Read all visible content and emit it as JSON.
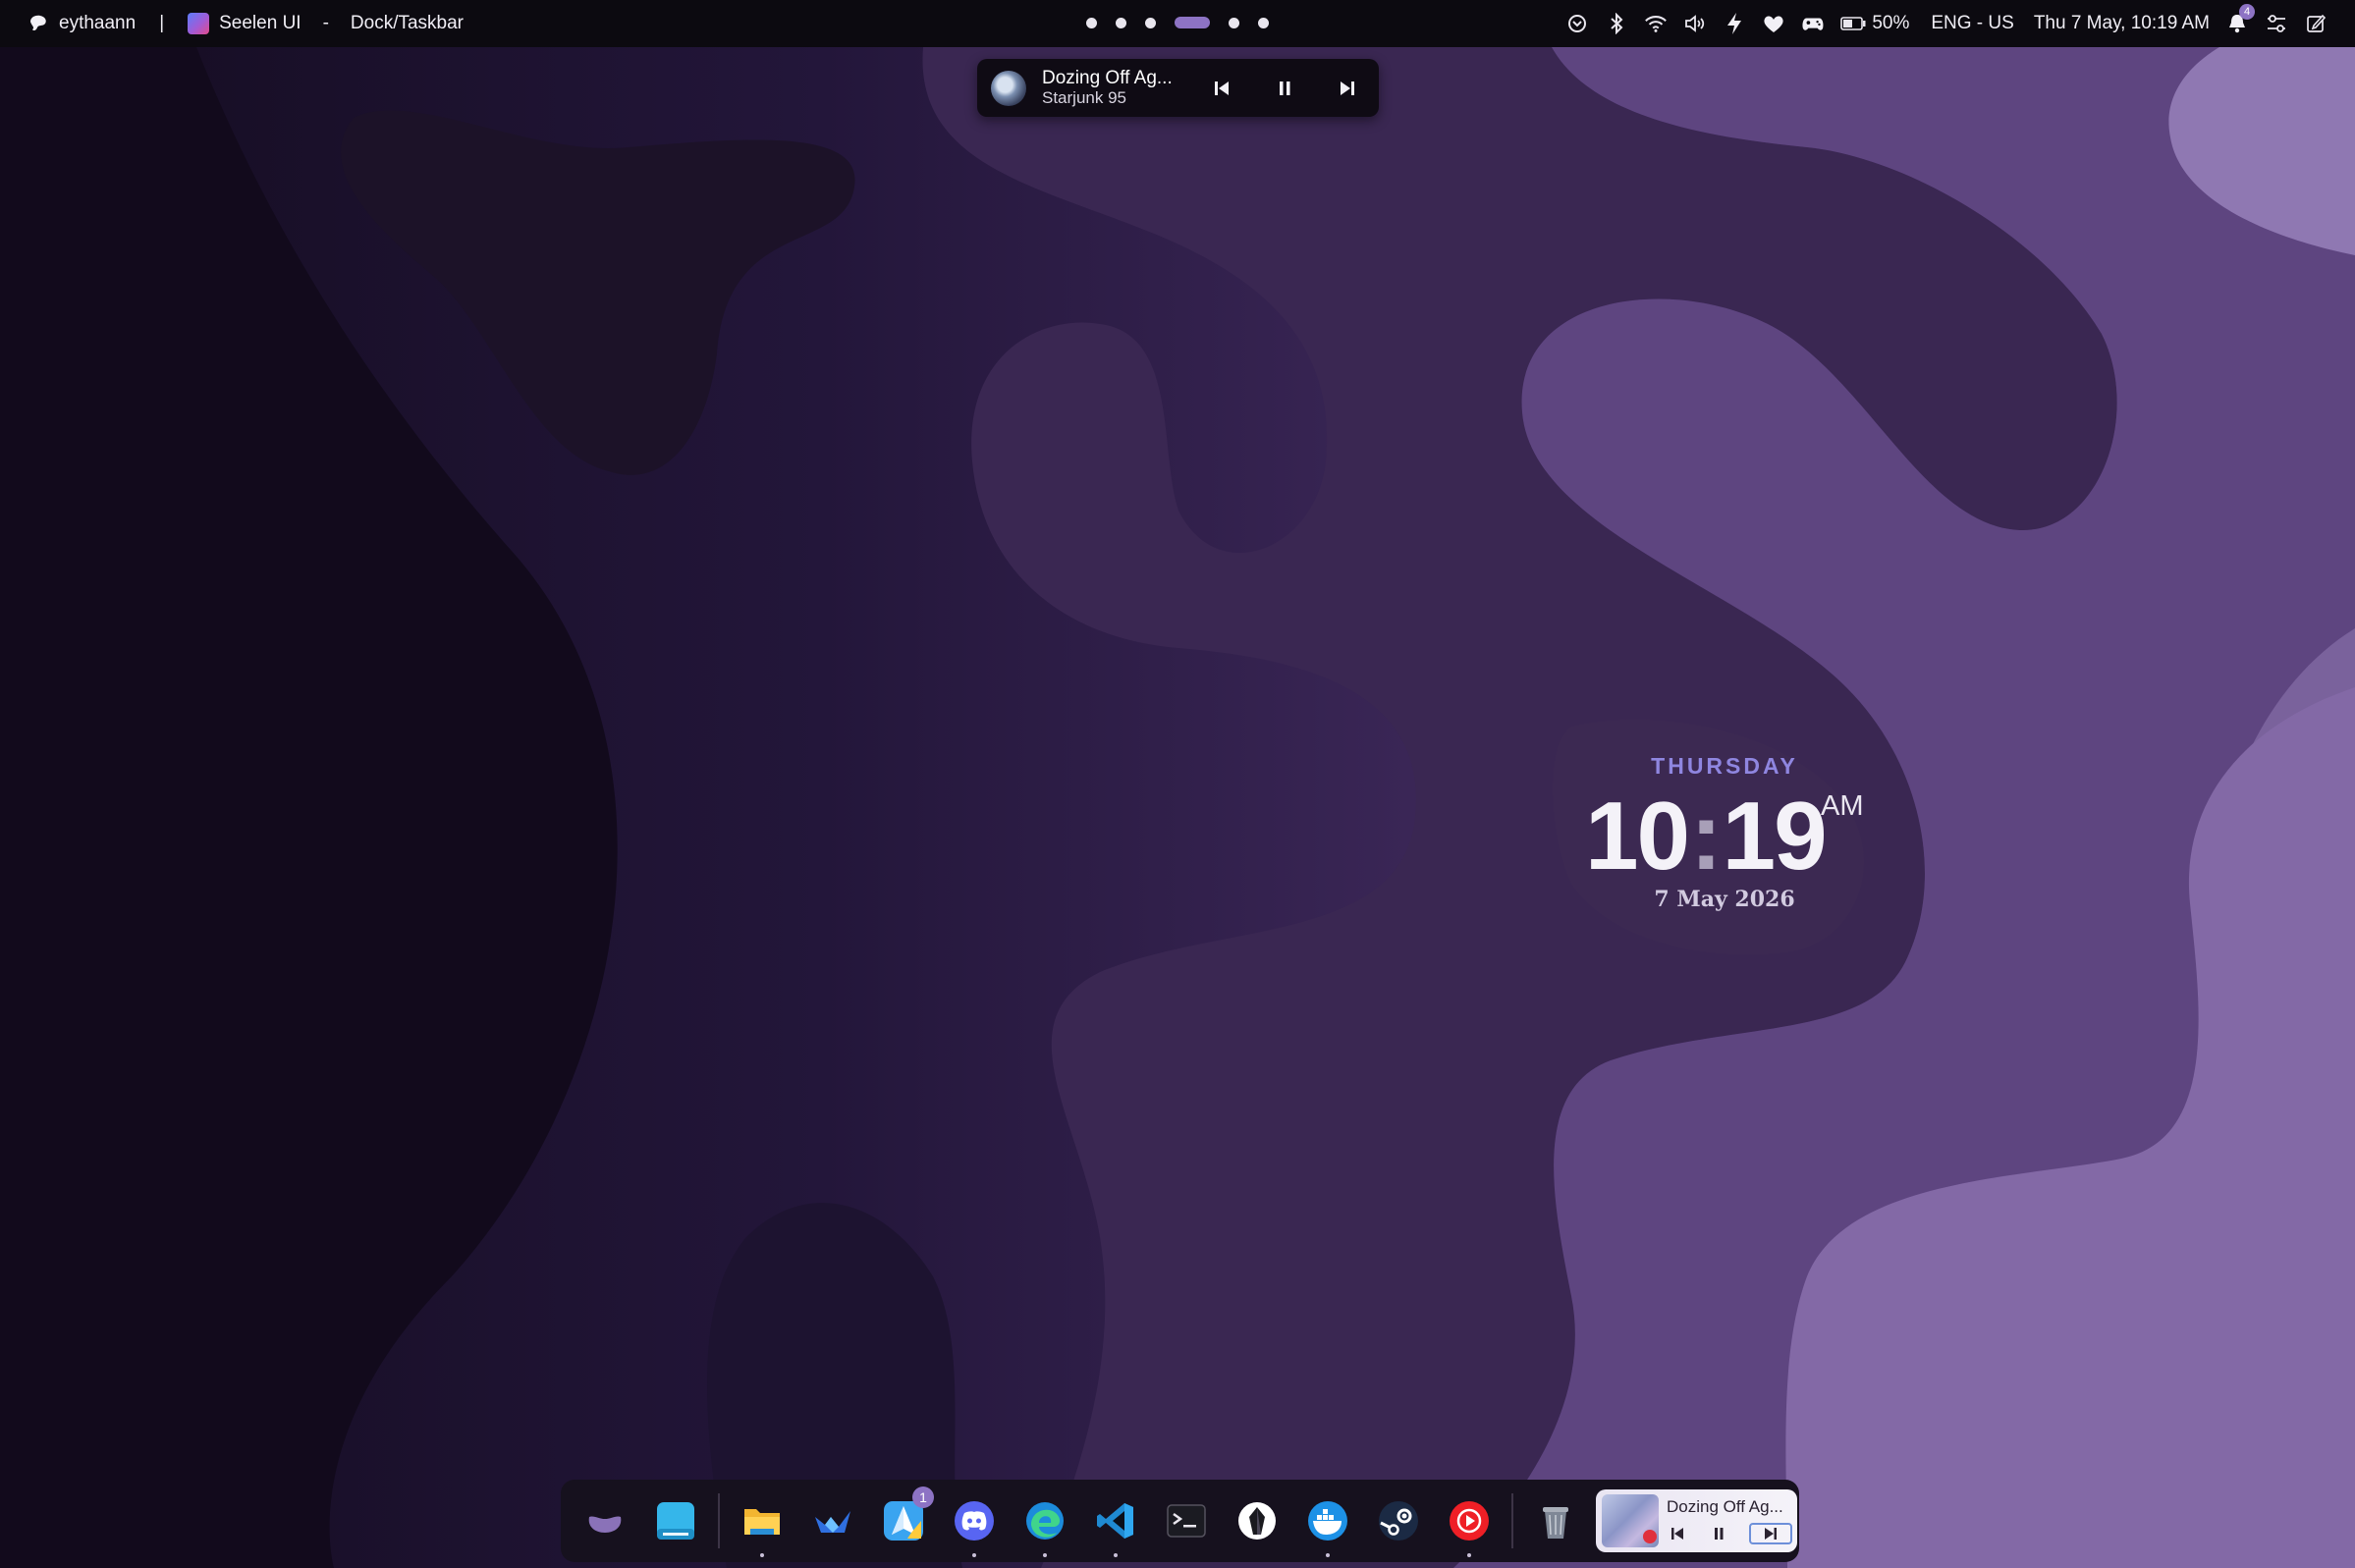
{
  "topbar": {
    "user_name": "eythaann",
    "separator": "|",
    "app_name": "Seelen UI",
    "title_separator": "-",
    "window_title": "Dock/Taskbar",
    "workspaces_count": 6,
    "active_workspace_index": 3,
    "battery_percent": "50%",
    "language": "ENG - US",
    "datetime": "Thu 7 May, 10:19 AM",
    "notification_count": "4"
  },
  "media_popup": {
    "title": "Dozing Off Ag...",
    "artist": "Starjunk 95"
  },
  "clock_widget": {
    "day": "THURSDAY",
    "hours": "10",
    "colon": ":",
    "minutes": "19",
    "ampm": "AM",
    "date": "7 May 2026"
  },
  "dock": {
    "items": [
      {
        "name": "seelen-app-launcher-icon",
        "running": false
      },
      {
        "name": "desktop-icon",
        "running": false
      },
      {
        "name": "file-explorer-icon",
        "running": true
      },
      {
        "name": "windsurf-icon",
        "running": false
      },
      {
        "name": "send-app-icon",
        "running": false,
        "badge": "1"
      },
      {
        "name": "discord-icon",
        "running": true
      },
      {
        "name": "edge-icon",
        "running": true
      },
      {
        "name": "vscode-icon",
        "running": true
      },
      {
        "name": "terminal-icon",
        "running": false
      },
      {
        "name": "obsidian-icon",
        "running": false
      },
      {
        "name": "docker-icon",
        "running": true
      },
      {
        "name": "steam-icon",
        "running": false
      },
      {
        "name": "youtube-music-icon",
        "running": true
      },
      {
        "name": "recycle-bin-icon",
        "running": false
      }
    ],
    "media": {
      "title": "Dozing Off Ag..."
    }
  },
  "colors": {
    "accent": "#8d73c4",
    "topbar_bg": "#0c0a10",
    "clock_day": "#8f86e0"
  }
}
